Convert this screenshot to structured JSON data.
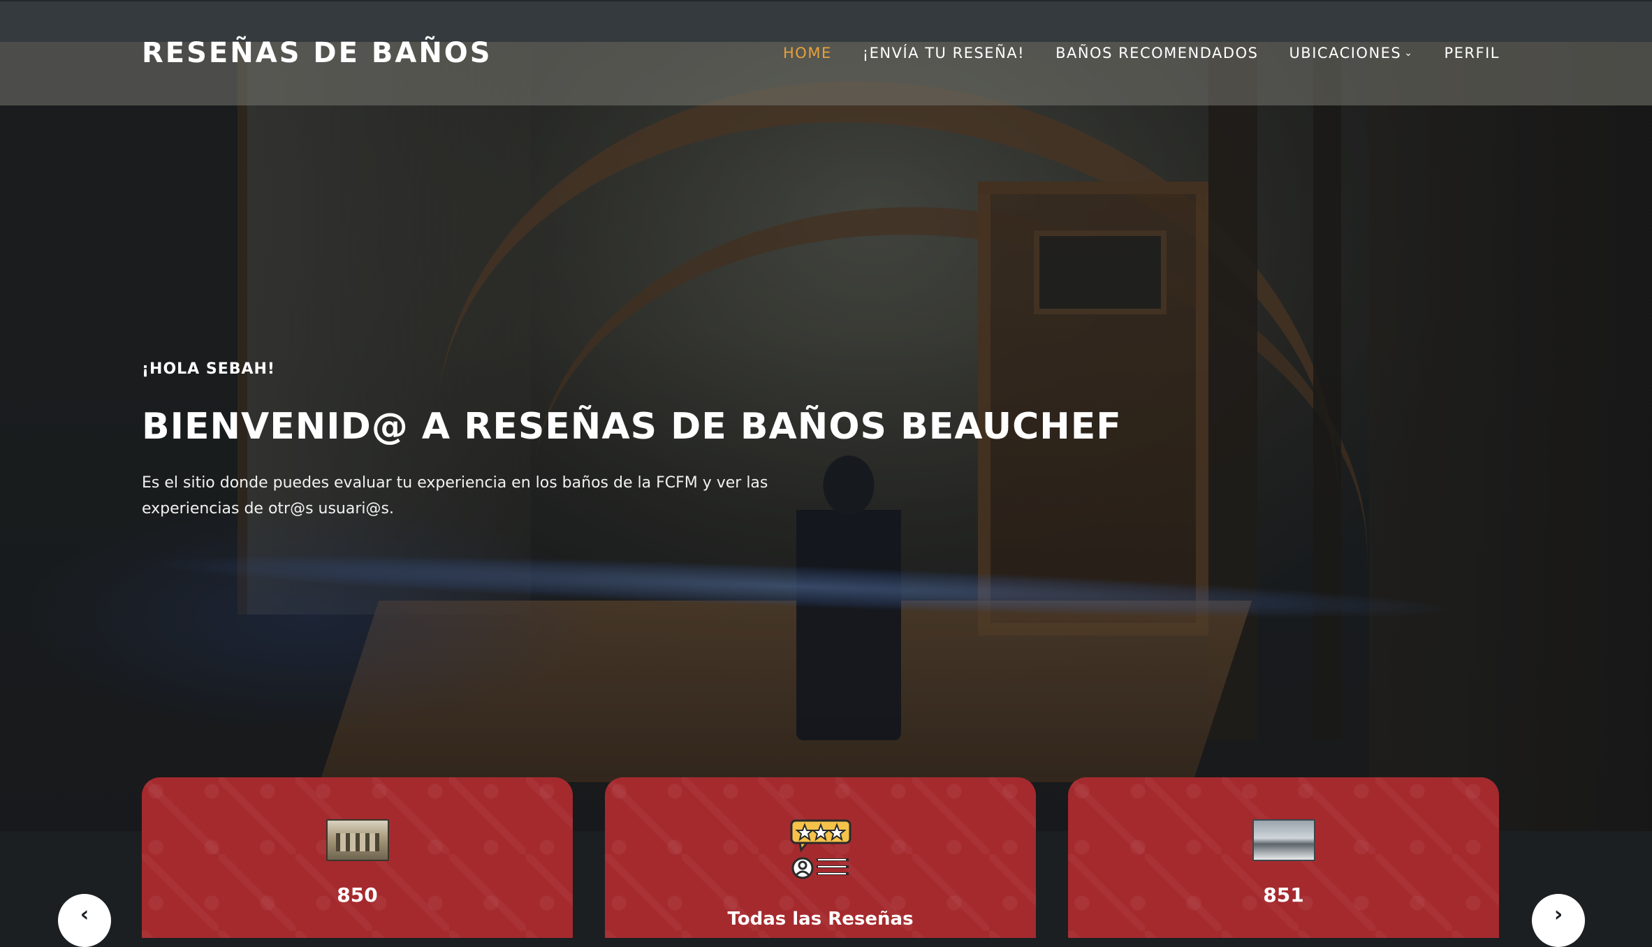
{
  "brand": "RESEÑAS DE BAÑOS",
  "nav": {
    "items": [
      {
        "label": "HOME",
        "active": true
      },
      {
        "label": "¡ENVÍA TU RESEÑA!",
        "active": false
      },
      {
        "label": "BAÑOS RECOMENDADOS",
        "active": false
      },
      {
        "label": "UBICACIONES",
        "active": false,
        "dropdown": true
      },
      {
        "label": "PERFIL",
        "active": false
      }
    ],
    "active_color": "#e8a13a"
  },
  "hero": {
    "greeting": "¡HOLA SEBAH!",
    "headline": "BIENVENID@ A RESEÑAS DE BAÑOS BEAUCHEF",
    "lead": "Es el sitio donde puedes evaluar tu experiencia en los baños de la FCFM y ver las experiencias de otr@s usuari@s."
  },
  "cards": [
    {
      "icon": "building-photo",
      "label": "850"
    },
    {
      "icon": "reviews-icon",
      "label": "Todas las Reseñas"
    },
    {
      "icon": "building-photo",
      "label": "851"
    }
  ],
  "carousel": {
    "prev_icon": "chevron-left-icon",
    "next_icon": "chevron-right-icon"
  },
  "colors": {
    "card_red": "#a52a2e",
    "nav_bg": "#767670",
    "top_strip": "#343a3d"
  }
}
